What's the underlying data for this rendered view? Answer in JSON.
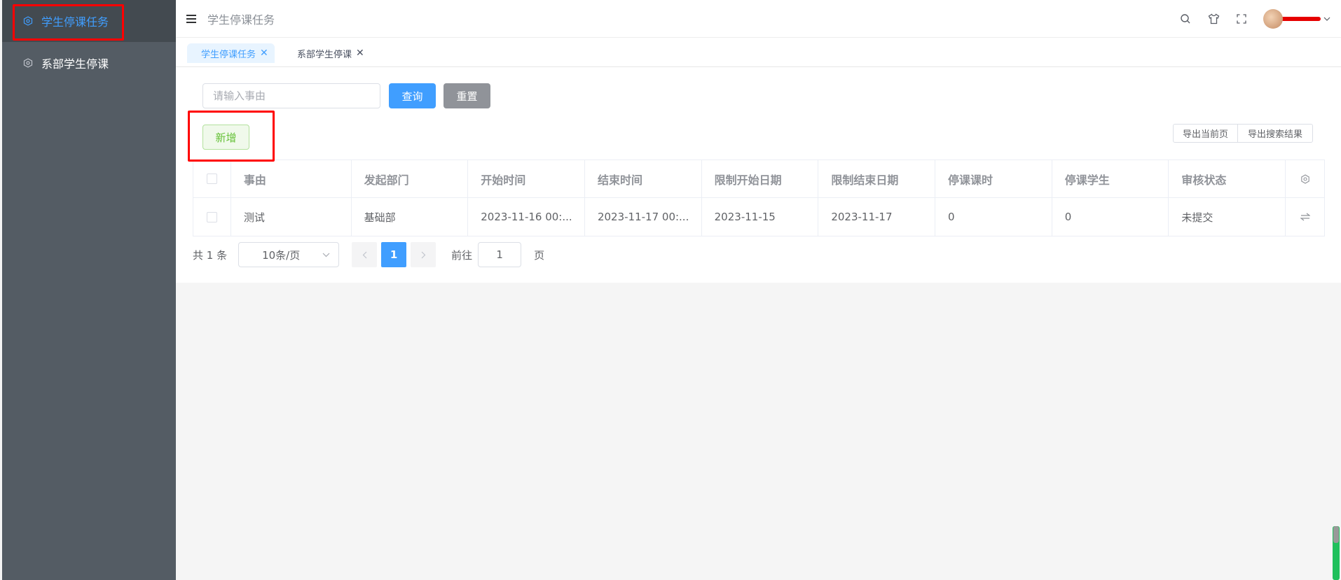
{
  "sidebar": {
    "items": [
      {
        "label": "学生停课任务",
        "icon": "hexagon-settings-icon",
        "active": true
      },
      {
        "label": "系部学生停课",
        "icon": "hexagon-settings-icon",
        "active": false
      }
    ]
  },
  "navbar": {
    "title": "学生停课任务",
    "icons": [
      "search-icon",
      "tshirt-icon",
      "fullscreen-icon"
    ]
  },
  "tabs": [
    {
      "label": "学生停课任务",
      "active": true
    },
    {
      "label": "系部学生停课",
      "active": false
    }
  ],
  "search": {
    "placeholder": "请输入事由",
    "value": ""
  },
  "buttons": {
    "query": "查询",
    "reset": "重置",
    "add": "新增",
    "export_current": "导出当前页",
    "export_search": "导出搜索结果"
  },
  "table": {
    "headers": [
      "事由",
      "发起部门",
      "开始时间",
      "结束时间",
      "限制开始日期",
      "限制结束日期",
      "停课课时",
      "停课学生",
      "审核状态"
    ],
    "rows": [
      [
        "测试",
        "基础部",
        "2023-11-16 00:...",
        "2023-11-17 00:...",
        "2023-11-15",
        "2023-11-17",
        "0",
        "0",
        "未提交"
      ]
    ]
  },
  "pagination": {
    "total": "共 1 条",
    "page_size": "10条/页",
    "current_page": "1",
    "goto_label": "前往",
    "goto_value": "1",
    "page_suffix": "页"
  },
  "colors": {
    "primary": "#409eff",
    "success": "#67c23a",
    "sidebar_bg": "#545c64",
    "annotation": "#ff0000"
  }
}
